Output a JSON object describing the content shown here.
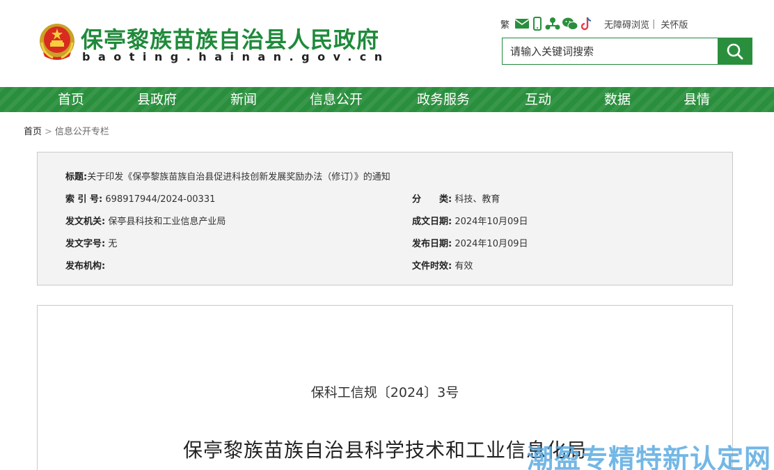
{
  "header": {
    "site_title": "保亭黎族苗族自治县人民政府",
    "site_domain": "baoting.hainan.gov.cn",
    "emblem_icon": "national-emblem-icon",
    "toolbar": {
      "traditional_label": "繁",
      "accessibility_label": "无障碍浏览",
      "separator": "|",
      "elder_label": "关怀版",
      "icons": [
        "mail-icon",
        "mobile-icon",
        "network-icon",
        "wechat-icon",
        "douyin-icon"
      ]
    },
    "search": {
      "placeholder": "请输入关键词搜索"
    },
    "accent_color": "#2a8f3d"
  },
  "nav": {
    "items": [
      "首页",
      "县政府",
      "新闻",
      "信息公开",
      "政务服务",
      "互动",
      "数据",
      "县情"
    ]
  },
  "breadcrumb": {
    "home": "首页",
    "separator": ">",
    "current": "信息公开专栏"
  },
  "meta": {
    "title_label": "标题:",
    "title_value": "关于印发《保亭黎族苗族自治县促进科技创新发展奖励办法（修订）》的通知",
    "index_label": "索 引 号:",
    "index_value": "698917944/2024-00331",
    "category_label": "分　　类:",
    "category_value": "科技、教育",
    "issuer_label": "发文机关:",
    "issuer_value": "保亭县科技和工业信息产业局",
    "created_label": "成文日期:",
    "created_value": "2024年10月09日",
    "docnum_label": "发文字号:",
    "docnum_value": "无",
    "published_label": "发布日期:",
    "published_value": "2024年10月09日",
    "org_label": "发布机构:",
    "org_value": "",
    "validity_label": "文件时效:",
    "validity_value": "有效"
  },
  "document": {
    "number": "保科工信规〔2024〕3号",
    "issuer_heading": "保亭黎族苗族自治县科学技术和工业信息化局"
  },
  "watermark": {
    "text": "潮盈专精特新认定网"
  }
}
